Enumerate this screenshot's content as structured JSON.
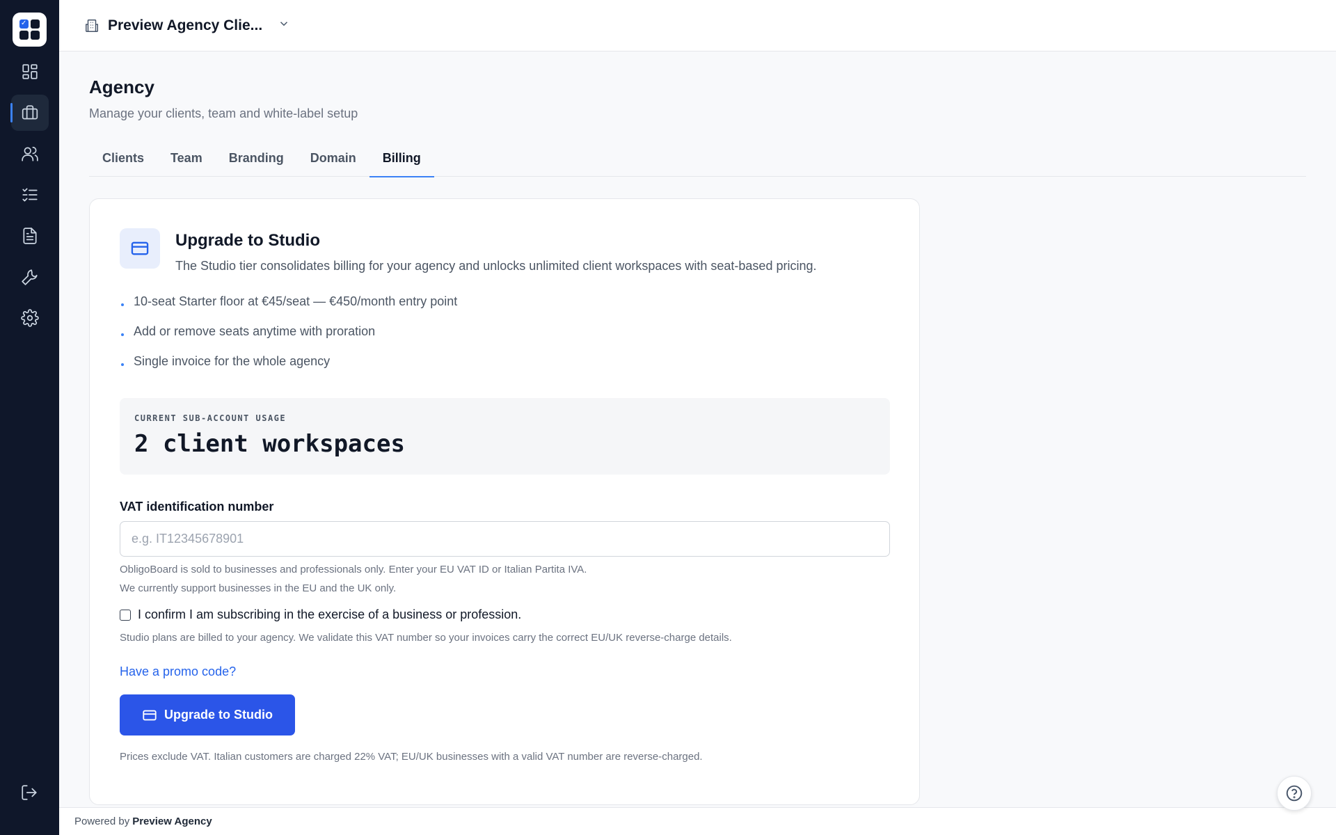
{
  "sidebar": {
    "logo_icon": "app-logo-icon",
    "items": [
      {
        "id": "dashboard",
        "icon": "grid-icon",
        "active": false
      },
      {
        "id": "agency",
        "icon": "briefcase-icon",
        "active": true
      },
      {
        "id": "people",
        "icon": "users-icon",
        "active": false
      },
      {
        "id": "tasks",
        "icon": "checklist-icon",
        "active": false
      },
      {
        "id": "documents",
        "icon": "document-icon",
        "active": false
      },
      {
        "id": "tools",
        "icon": "wrench-icon",
        "active": false
      },
      {
        "id": "settings",
        "icon": "gear-icon",
        "active": false
      }
    ],
    "logout_icon": "logout-icon"
  },
  "topbar": {
    "workspace_name": "Preview Agency Clie...",
    "workspace_icon": "building-icon"
  },
  "page": {
    "title": "Agency",
    "subtitle": "Manage your clients, team and white-label setup"
  },
  "tabs": [
    {
      "label": "Clients",
      "active": false
    },
    {
      "label": "Team",
      "active": false
    },
    {
      "label": "Branding",
      "active": false
    },
    {
      "label": "Domain",
      "active": false
    },
    {
      "label": "Billing",
      "active": true
    }
  ],
  "card": {
    "icon": "credit-card-icon",
    "title": "Upgrade to Studio",
    "description": "The Studio tier consolidates billing for your agency and unlocks unlimited client workspaces with seat-based pricing.",
    "bullets": [
      "10-seat Starter floor at €45/seat — €450/month entry point",
      "Add or remove seats anytime with proration",
      "Single invoice for the whole agency"
    ],
    "usage": {
      "label": "CURRENT SUB-ACCOUNT USAGE",
      "value": "2 client workspaces"
    },
    "vat": {
      "label": "VAT identification number",
      "placeholder": "e.g. IT12345678901",
      "value": "",
      "help_line1": "ObligoBoard is sold to businesses and professionals only. Enter your EU VAT ID or Italian Partita IVA.",
      "help_line2": "We currently support businesses in the EU and the UK only."
    },
    "confirm": {
      "label": "I confirm I am subscribing in the exercise of a business or profession.",
      "checked": false,
      "help": "Studio plans are billed to your agency. We validate this VAT number so your invoices carry the correct EU/UK reverse-charge details."
    },
    "promo_label": "Have a promo code?",
    "upgrade_button": "Upgrade to Studio",
    "fine_print": "Prices exclude VAT. Italian customers are charged 22% VAT; EU/UK businesses with a valid VAT number are reverse-charged."
  },
  "footer": {
    "powered_by": "Powered by",
    "brand": "Preview Agency"
  },
  "help_icon": "help-circle-icon",
  "colors": {
    "sidebar_bg": "#0f172a",
    "accent": "#2b55e8",
    "link": "#2563eb"
  }
}
